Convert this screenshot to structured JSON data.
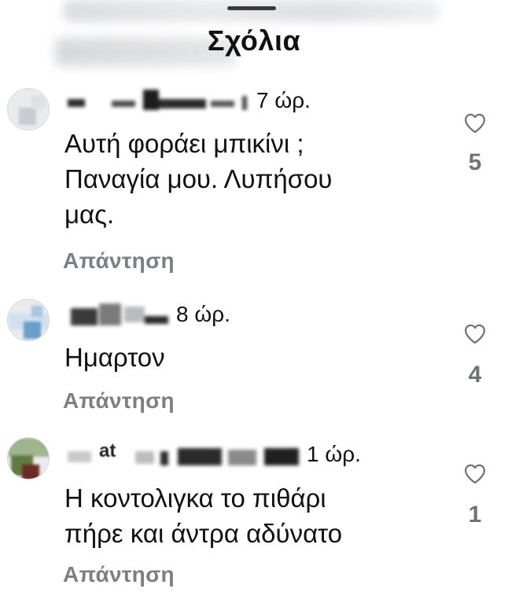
{
  "sheet": {
    "title": "Σχόλια"
  },
  "comments": [
    {
      "time": "7 ώρ.",
      "text_lines": [
        "Αυτή φοράει μπικίνι ;",
        "Παναγία μου. Λυπήσου",
        "μας."
      ],
      "reply_label": "Απάντηση",
      "like_count": "5"
    },
    {
      "time": "8 ώρ.",
      "text_lines": [
        "Ημαρτον"
      ],
      "reply_label": "Απάντηση",
      "like_count": "4"
    },
    {
      "time": "1 ώρ.",
      "name_fragment": "at",
      "text_lines": [
        "Η κοντολιγκα το πιθάρι",
        "πήρε και άντρα αδύνατο"
      ],
      "reply_label": "Απάντηση",
      "like_count": "1"
    }
  ],
  "icons": {
    "like": "heart-outline-icon"
  },
  "colors": {
    "text": "#111111",
    "secondary": "#7c7f84",
    "background": "#ffffff"
  }
}
